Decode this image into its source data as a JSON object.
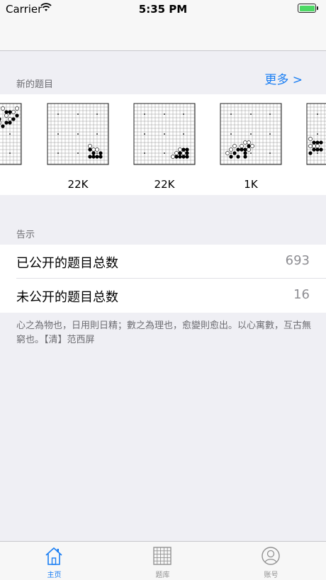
{
  "status_bar": {
    "carrier": "Carrier",
    "time": "5:35 PM",
    "battery_level": 1.0
  },
  "new_problems": {
    "header": "新的题目",
    "more_label": "更多 >",
    "items": [
      {
        "rank": ""
      },
      {
        "rank": "22K"
      },
      {
        "rank": "22K"
      },
      {
        "rank": "1K"
      },
      {
        "rank": ""
      }
    ]
  },
  "notice": {
    "header": "告示",
    "rows": [
      {
        "label": "已公开的题目总数",
        "value": "693"
      },
      {
        "label": "未公开的题目总数",
        "value": "16"
      }
    ],
    "footer": "心之為物也，日用則日精；數之為理也，愈變則愈出。以心寓數，互古無窮也。【清】范西屏"
  },
  "tab_bar": {
    "tabs": [
      {
        "label": "主页",
        "icon": "home-icon",
        "active": true
      },
      {
        "label": "题库",
        "icon": "grid-icon",
        "active": false
      },
      {
        "label": "账号",
        "icon": "user-icon",
        "active": false
      }
    ]
  },
  "colors": {
    "accent": "#1a7ef3",
    "background": "#efeff4",
    "battery": "#4cd964"
  }
}
